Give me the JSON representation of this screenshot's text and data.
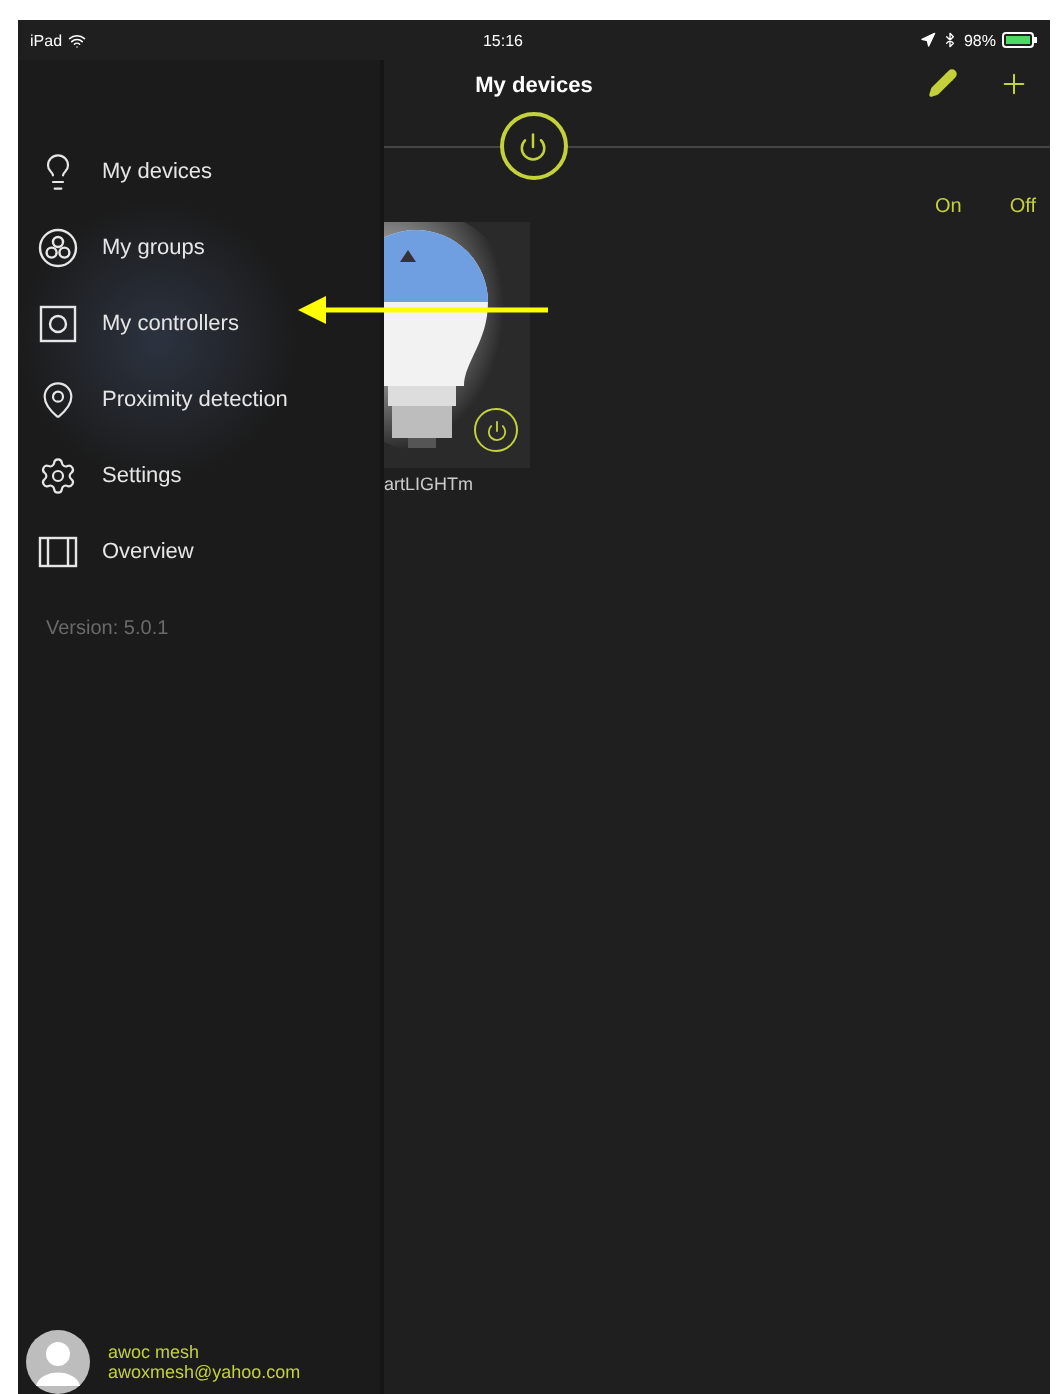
{
  "status_bar": {
    "carrier": "iPad",
    "time": "15:16",
    "battery": "98%"
  },
  "header": {
    "title": "My devices"
  },
  "filter": {
    "on_label": "On",
    "off_label": "Off"
  },
  "devices": [
    {
      "name": "artLIGHTm",
      "kind": "picture"
    }
  ],
  "menu": [
    {
      "label": "My devices",
      "kind": "bulb"
    },
    {
      "label": "My groups",
      "kind": "groups"
    },
    {
      "label": "My controllers",
      "kind": "controller"
    },
    {
      "label": "Proximity detection",
      "kind": "pin"
    },
    {
      "label": "Settings",
      "kind": "gear"
    },
    {
      "label": "Overview",
      "kind": "overview"
    }
  ],
  "version": "Version: 5.0.1",
  "user": {
    "name": "awoc mesh",
    "email": "awoxmesh@yahoo.com"
  }
}
